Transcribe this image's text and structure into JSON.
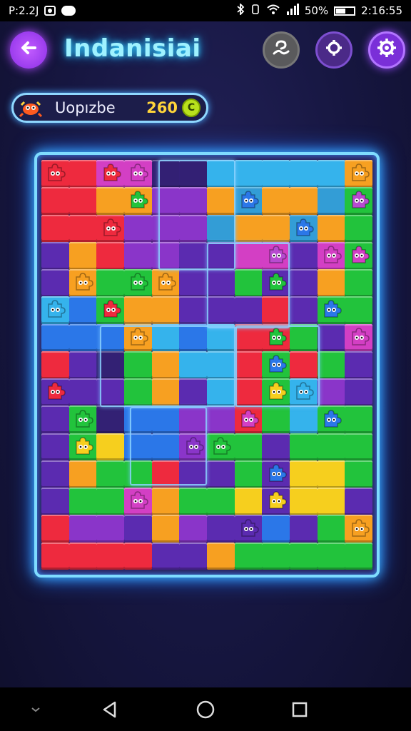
{
  "status_bar": {
    "time_left": "P:2.2J",
    "battery": "50%",
    "time_right": "2:16:55"
  },
  "header": {
    "title": "Indanisiai"
  },
  "score_panel": {
    "label": "Uopızbe",
    "score": "260",
    "coin_glyph": "C"
  },
  "icons": {
    "back": "back-arrow-icon",
    "hint": "hint-icon",
    "theme": "theme-icon",
    "settings": "gear-icon",
    "coin": "coin-icon",
    "piece": "puzzle-piece-icon"
  },
  "colors": {
    "accent_cyan": "#7fdcff",
    "accent_purple": "#9a4bff",
    "score_yellow": "#ffd53a",
    "red": "#ee2a3e",
    "orange": "#f7a021",
    "yellow": "#f6cf1e",
    "green": "#22c33c",
    "blue": "#2b77e8",
    "sky": "#35b3ec",
    "purple": "#8a35c9",
    "magenta": "#d33fc4",
    "violet": "#5b2bb0",
    "dark": "#35227a"
  },
  "board": {
    "cols": 12,
    "rows": 15,
    "tiles": [
      "RRMMDDSSSSSO",
      "RROOVVOKOOKG",
      "RRRVVVKOOKOG",
      "PORVVPPMMPMG",
      "POGGOPPGPPOG",
      "SBGOOPPPRPGG",
      "BBBOSBSRRGPM",
      "RPDGOSSRGRGP",
      "PPPGOPSRGSVP",
      "PGDBBVVRGSGG",
      "PGYBBVGGPGGG",
      "POGGRPPGPYYG",
      "PGGMOGGYPYYP",
      "RVVPOVPPBPGO",
      "RRRRPPOGGGGG"
    ],
    "pieces": [
      {
        "c": 0,
        "r": 0,
        "color": "#ee2a3e"
      },
      {
        "c": 2,
        "r": 0,
        "color": "#ee2a3e"
      },
      {
        "c": 3,
        "r": 0,
        "color": "#d33fc4"
      },
      {
        "c": 11,
        "r": 0,
        "color": "#f7a021"
      },
      {
        "c": 3,
        "r": 1,
        "color": "#22c33c"
      },
      {
        "c": 7,
        "r": 1,
        "color": "#2b77e8"
      },
      {
        "c": 11,
        "r": 1,
        "color": "#b84bd0"
      },
      {
        "c": 2,
        "r": 2,
        "color": "#ee2a3e"
      },
      {
        "c": 9,
        "r": 2,
        "color": "#2b77e8"
      },
      {
        "c": 8,
        "r": 3,
        "color": "#b84bd0"
      },
      {
        "c": 10,
        "r": 3,
        "color": "#d33fc4"
      },
      {
        "c": 11,
        "r": 3,
        "color": "#d33fc4"
      },
      {
        "c": 1,
        "r": 4,
        "color": "#f7a021"
      },
      {
        "c": 3,
        "r": 4,
        "color": "#22c33c"
      },
      {
        "c": 4,
        "r": 4,
        "color": "#f7a021"
      },
      {
        "c": 8,
        "r": 4,
        "color": "#22c33c"
      },
      {
        "c": 0,
        "r": 5,
        "color": "#35b3ec"
      },
      {
        "c": 2,
        "r": 5,
        "color": "#ee2a3e"
      },
      {
        "c": 10,
        "r": 5,
        "color": "#2b77e8"
      },
      {
        "c": 3,
        "r": 6,
        "color": "#f7a021"
      },
      {
        "c": 8,
        "r": 6,
        "color": "#22c33c"
      },
      {
        "c": 11,
        "r": 6,
        "color": "#d33fc4"
      },
      {
        "c": 8,
        "r": 7,
        "color": "#2b77e8"
      },
      {
        "c": 0,
        "r": 8,
        "color": "#ee2a3e"
      },
      {
        "c": 8,
        "r": 8,
        "color": "#f6cf1e"
      },
      {
        "c": 9,
        "r": 8,
        "color": "#35b3ec"
      },
      {
        "c": 1,
        "r": 9,
        "color": "#22c33c"
      },
      {
        "c": 7,
        "r": 9,
        "color": "#d33fc4"
      },
      {
        "c": 10,
        "r": 9,
        "color": "#2b77e8"
      },
      {
        "c": 1,
        "r": 10,
        "color": "#f6cf1e"
      },
      {
        "c": 5,
        "r": 10,
        "color": "#8a35c9"
      },
      {
        "c": 6,
        "r": 10,
        "color": "#22c33c"
      },
      {
        "c": 8,
        "r": 11,
        "color": "#2b77e8"
      },
      {
        "c": 3,
        "r": 12,
        "color": "#d33fc4"
      },
      {
        "c": 8,
        "r": 12,
        "color": "#f6cf1e"
      },
      {
        "c": 7,
        "r": 13,
        "color": "#5b2bb0"
      },
      {
        "c": 11,
        "r": 13,
        "color": "#f7a021"
      }
    ]
  },
  "nav": {
    "back": "nav-back-icon",
    "home": "nav-home-icon",
    "recents": "nav-recents-icon"
  }
}
